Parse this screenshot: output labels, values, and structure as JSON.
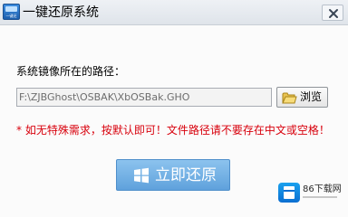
{
  "window": {
    "title": "一键还原系统",
    "icon": "app-disk-icon",
    "icon_text": "一键还原"
  },
  "form": {
    "path_label": "系统镜像所在的路径：",
    "path_value": "F:\\ZJBGhost\\OSBAK\\XbOSBak.GHO",
    "browse_label": "浏览",
    "warning": "* 如无特殊需求，按默认即可！文件路径请不要存在中文或空格！",
    "restore_label": "立即还原"
  },
  "watermark": {
    "text": "86下载网"
  },
  "colors": {
    "warning": "#d8000c",
    "restore_button": "#6fb0e4",
    "titlebar": "#e6eaef"
  },
  "icons": {
    "close": "close-icon",
    "folder": "folder-icon",
    "windows": "windows-logo-icon"
  }
}
